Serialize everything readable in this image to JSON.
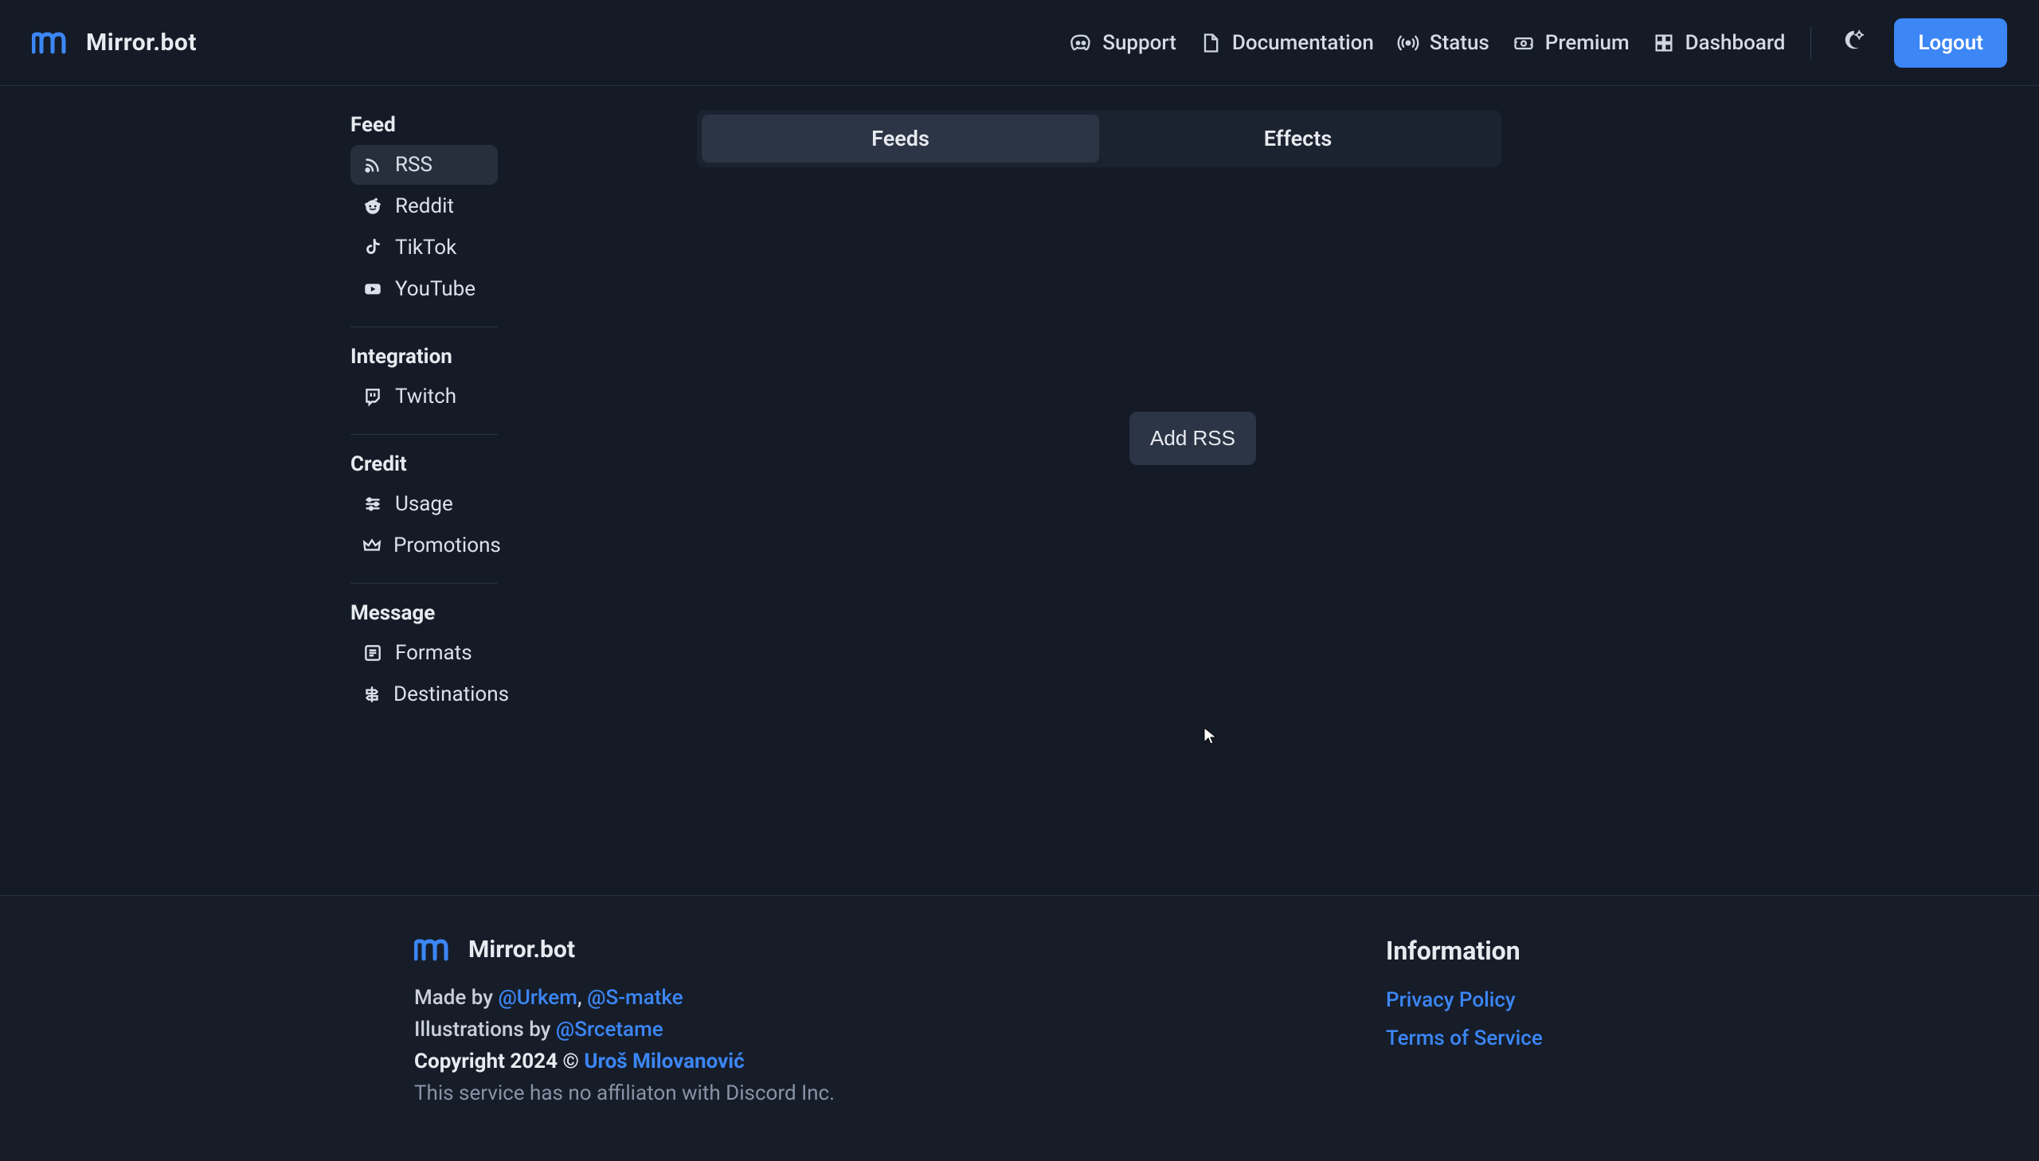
{
  "brand": {
    "name": "Mirror.bot"
  },
  "nav": {
    "support": "Support",
    "documentation": "Documentation",
    "status": "Status",
    "premium": "Premium",
    "dashboard": "Dashboard",
    "logout": "Logout"
  },
  "sidebar": {
    "sections": [
      {
        "heading": "Feed",
        "items": [
          {
            "icon": "rss",
            "label": "RSS",
            "active": true
          },
          {
            "icon": "reddit",
            "label": "Reddit"
          },
          {
            "icon": "tiktok",
            "label": "TikTok"
          },
          {
            "icon": "youtube",
            "label": "YouTube"
          }
        ]
      },
      {
        "heading": "Integration",
        "items": [
          {
            "icon": "twitch",
            "label": "Twitch"
          }
        ]
      },
      {
        "heading": "Credit",
        "items": [
          {
            "icon": "sliders",
            "label": "Usage"
          },
          {
            "icon": "crown",
            "label": "Promotions"
          }
        ]
      },
      {
        "heading": "Message",
        "items": [
          {
            "icon": "list-box",
            "label": "Formats"
          },
          {
            "icon": "signpost",
            "label": "Destinations"
          }
        ]
      }
    ]
  },
  "tabs": {
    "feeds": "Feeds",
    "effects": "Effects",
    "active": "feeds"
  },
  "main": {
    "add_button": "Add RSS"
  },
  "footer": {
    "brand": "Mirror.bot",
    "made_by_prefix": "Made by ",
    "made_by_1": "@Urkem",
    "made_by_sep": ", ",
    "made_by_2": "@S-matke",
    "illustrations_prefix": "Illustrations by ",
    "illustrations_by": "@Srcetame",
    "copyright_prefix": "Copyright 2024 © ",
    "copyright_name": "Uroš Milovanović",
    "disclaimer": "This service has no affiliaton with Discord Inc.",
    "info_heading": "Information",
    "link_privacy": "Privacy Policy",
    "link_tos": "Terms of Service"
  }
}
